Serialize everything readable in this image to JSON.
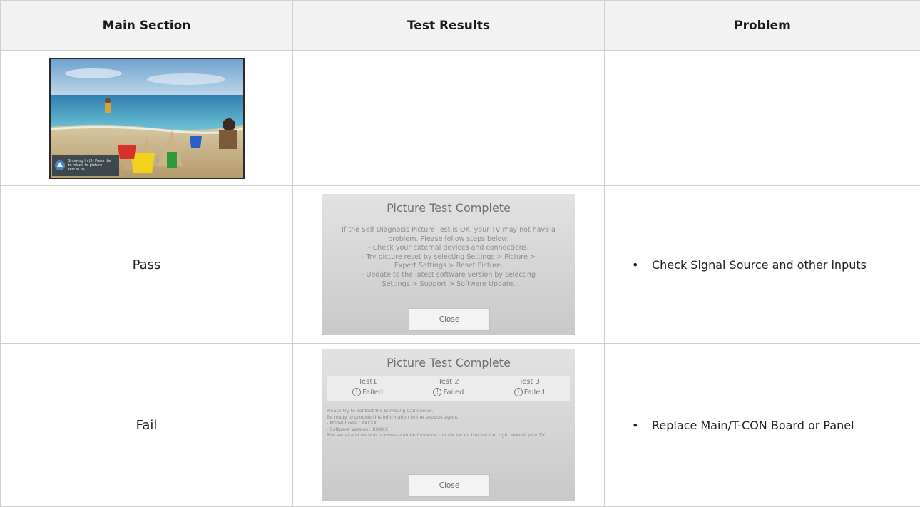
{
  "headers": [
    "Main Section",
    "Test Results",
    "Problem"
  ],
  "picture_osd_text": [
    "Showing in (3) Press the",
    "to return to picture",
    "test in 3s."
  ],
  "rows": [
    {
      "main": "Pass",
      "problem": "Check Signal Source and other inputs"
    },
    {
      "main": "Fail",
      "problem": "Replace Main/T-CON Board or Panel"
    }
  ],
  "pass_dialog": {
    "title": "Picture Test Complete",
    "lines": [
      "If the Self Diagnosis Picture Test is OK, your TV may not have a",
      "problem. Please follow steps below:",
      "- Check your external devices and connections.",
      "- Try picture reset by selecting Settings > Picture >",
      "Expert Settings > Reset Picture.",
      "- Update to the latest software version by selecting",
      "Settings > Support > Software Update."
    ],
    "close_label": "Close"
  },
  "fail_dialog": {
    "title": "Picture Test Complete",
    "tests": [
      {
        "name": "Test1",
        "status": "Failed"
      },
      {
        "name": "Test 2",
        "status": "Failed"
      },
      {
        "name": "Test 3",
        "status": "Failed"
      }
    ],
    "status_icon": "!",
    "lines": [
      "Please try to contact the Samsung Call Center.",
      "Be ready to provide this information to the support agent.",
      "- Model Code : XXXXX",
      "- Software Version : XXXXX",
      "The serial and version numbers can be found on the sticker on the back or right side of your TV."
    ],
    "close_label": "Close"
  },
  "bullet": "•"
}
